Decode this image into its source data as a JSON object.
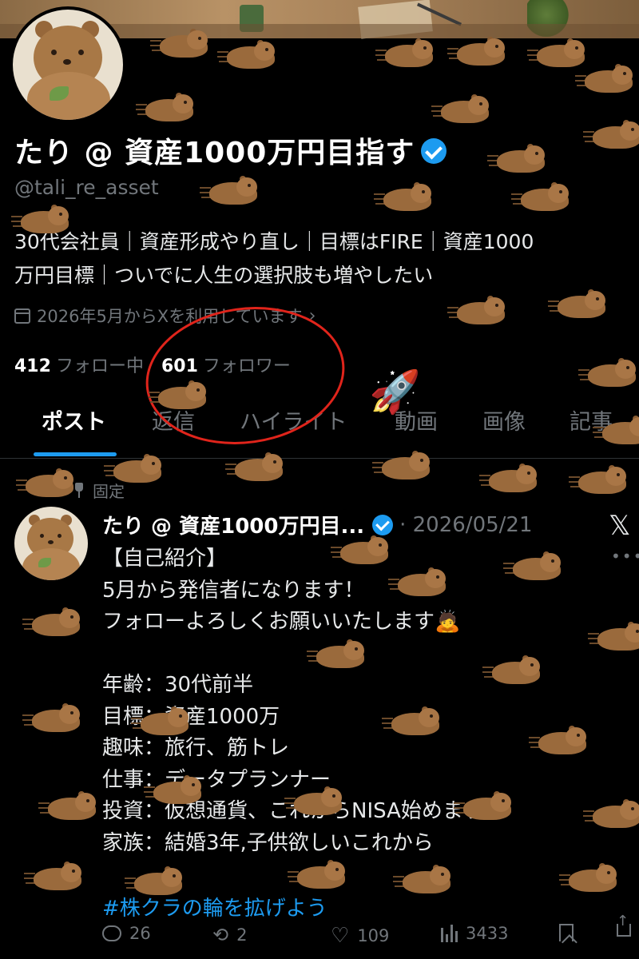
{
  "profile": {
    "name": "たり @ 資産1000万円目指す",
    "handle": "@tali_re_asset",
    "bio_line1": "30代会社員｜資産形成やり直し｜目標はFIRE｜資産1000",
    "bio_line2": "万円目標｜ついでに人生の選択肢も増やしたい",
    "joined": "2026年5月からXを利用しています",
    "following_count": "412",
    "following_label": "フォロー中",
    "followers_count": "601",
    "followers_label": "フォロワー"
  },
  "tabs": [
    "ポスト",
    "返信",
    "ハイライト",
    "動画",
    "画像",
    "記事"
  ],
  "active_tab": "ポスト",
  "post": {
    "pinned_label": "固定",
    "author": "たり @ 資産1000万円目...",
    "date": "· 2026/05/21",
    "x_logo": "𝕏",
    "more": "•••",
    "lines": [
      "【自己紹介】",
      "5月から発信者になります！",
      "フォローよろしくお願いいたします🙇",
      "",
      "年齢：30代前半",
      "目標：資産1000万",
      "趣味：旅行、筋トレ",
      "仕事：データプランナー",
      "投資：仮想通貨、これからNISA始めます",
      "家族：結婚3年,子供欲しいこれから"
    ],
    "hashtag": "#株クラの輪を拡げよう",
    "replies": "26",
    "reposts": "2",
    "likes": "109",
    "views": "3433"
  },
  "decor": {
    "rocket": "🚀",
    "retweet_glyph": "⟲",
    "heart_glyph": "♡"
  },
  "colors": {
    "accent": "#1d9bf0",
    "annotation_circle": "#e0241b",
    "muted": "#71767b"
  }
}
